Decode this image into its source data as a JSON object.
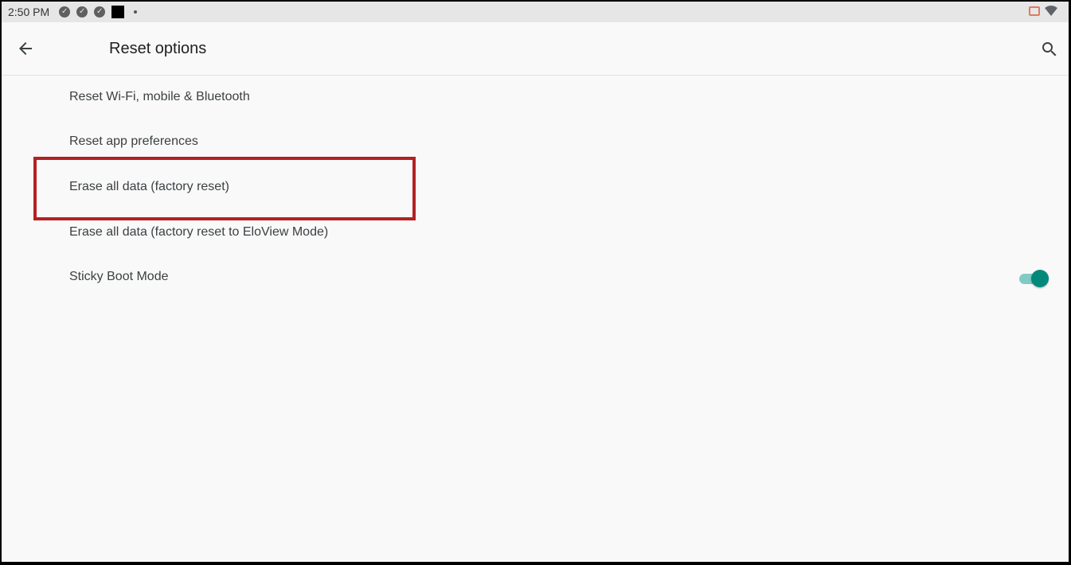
{
  "status_bar": {
    "time": "2:50 PM",
    "icons": [
      "check-circle-icon",
      "check-circle-icon",
      "check-circle-icon",
      "square-notification-icon",
      "dot-icon"
    ],
    "right_icons": [
      "cast-icon",
      "wifi-icon"
    ]
  },
  "app_bar": {
    "title": "Reset options",
    "back_icon": "arrow-back-icon",
    "search_icon": "search-icon"
  },
  "items": [
    {
      "label": "Reset Wi-Fi, mobile & Bluetooth"
    },
    {
      "label": "Reset app preferences"
    },
    {
      "label": "Erase all data (factory reset)"
    },
    {
      "label": "Erase all data (factory reset to EloView Mode)"
    },
    {
      "label": "Sticky Boot Mode",
      "toggle": true
    }
  ],
  "colors": {
    "accent": "#00897b",
    "highlight": "#b22222"
  }
}
